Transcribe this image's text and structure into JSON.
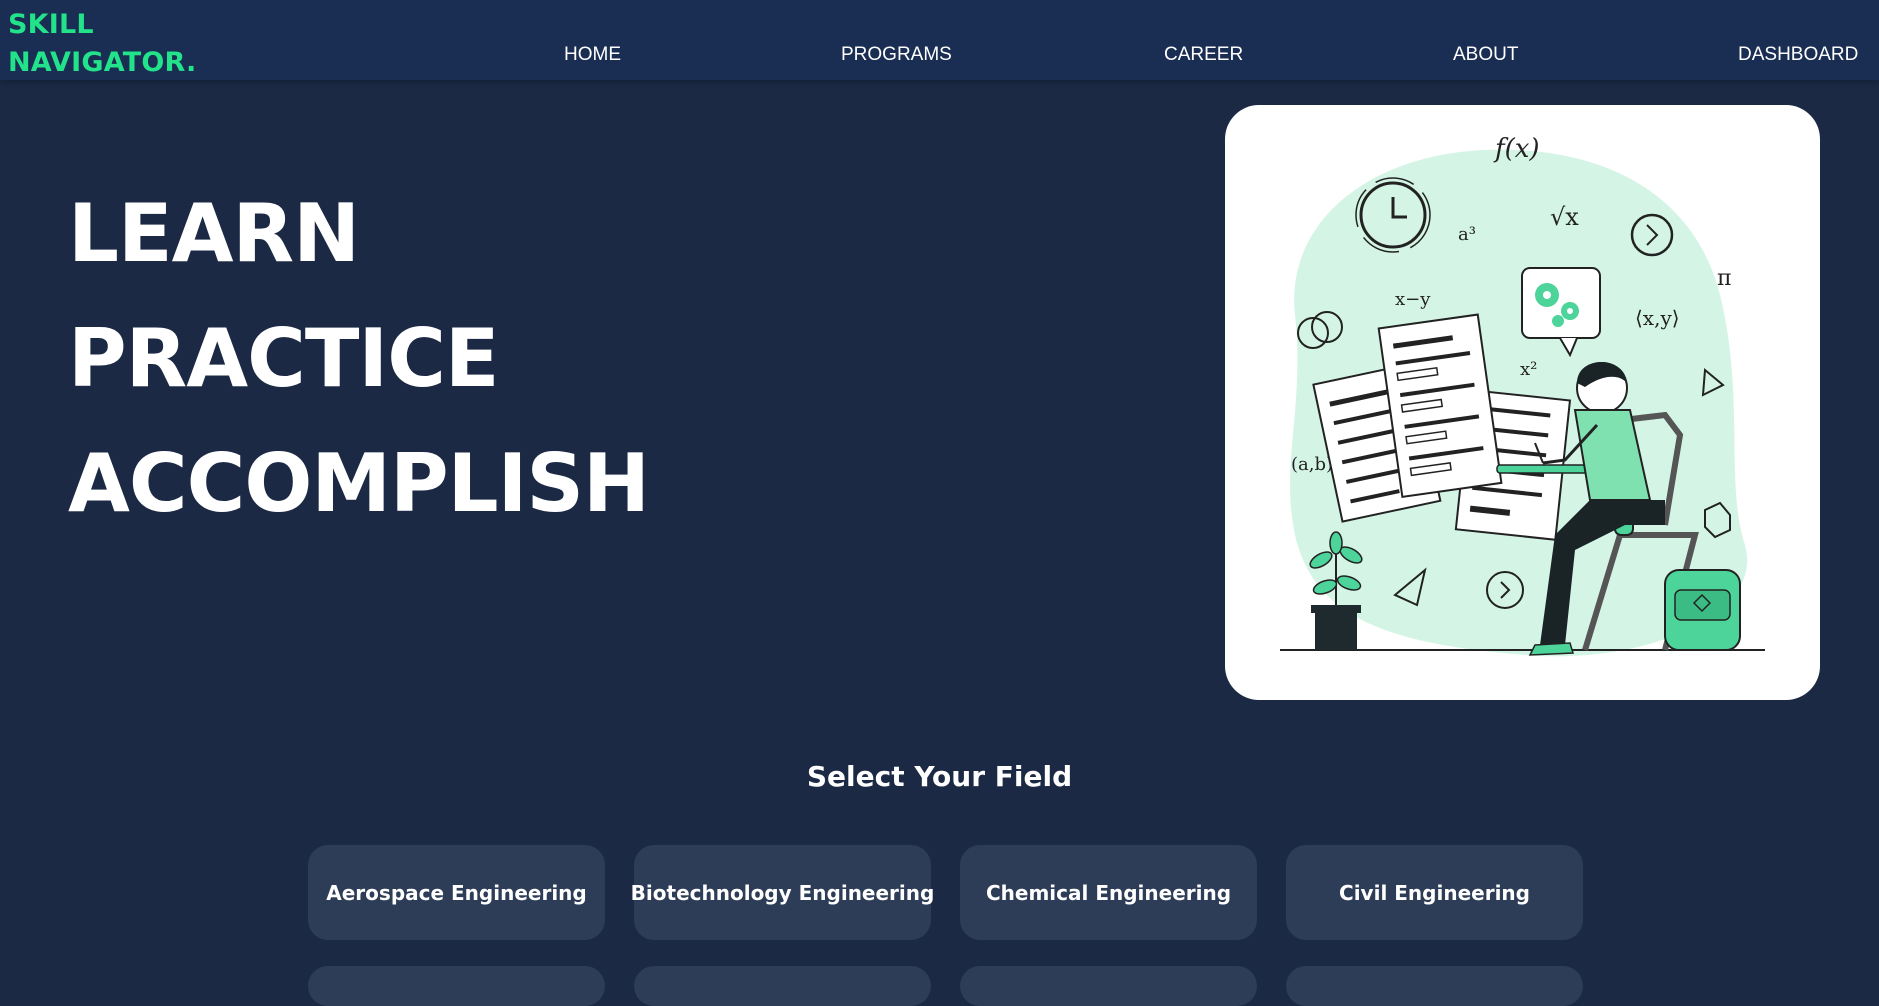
{
  "brand": {
    "line1": "SKILL",
    "line2": "NAVIGATOR.",
    "color": "#22e38a"
  },
  "nav": {
    "items": [
      {
        "label": "HOME"
      },
      {
        "label": "PROGRAMS"
      },
      {
        "label": "CAREER"
      },
      {
        "label": "ABOUT"
      },
      {
        "label": "DASHBOARD"
      }
    ]
  },
  "hero": {
    "lines": [
      "LEARN",
      "PRACTICE",
      "ACCOMPLISH"
    ],
    "illustration": "student-taking-test-illustration"
  },
  "fields": {
    "title": "Select Your Field",
    "items": [
      {
        "label": "Aerospace Engineering"
      },
      {
        "label": "Biotechnology Engineering"
      },
      {
        "label": "Chemical Engineering"
      },
      {
        "label": "Civil Engineering"
      }
    ]
  },
  "colors": {
    "background": "#1b2944",
    "navbar": "#1a2d52",
    "accent": "#22e38a",
    "button": "#2e3d57",
    "illustration_accent": "#4dd49a"
  }
}
